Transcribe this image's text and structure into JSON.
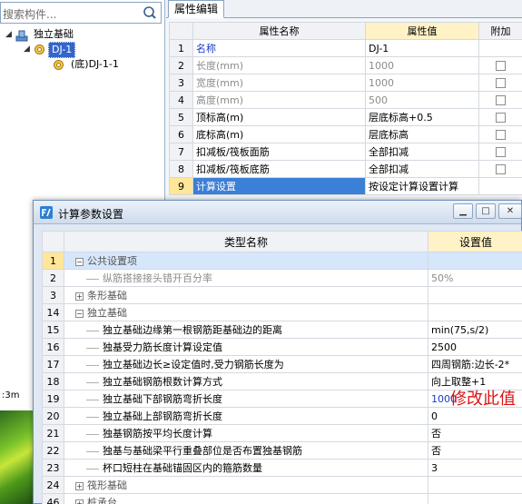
{
  "search": {
    "placeholder": "搜索构件..."
  },
  "tree": {
    "root_label": "独立基础",
    "child_label": "DJ-1",
    "grandchild_label": "(底)DJ-1-1"
  },
  "status": {
    "text": ":3m"
  },
  "property_panel": {
    "tab_label": "属性编辑",
    "headers": {
      "name": "属性名称",
      "value": "属性值",
      "extra": "附加"
    },
    "rows": [
      {
        "num": "1",
        "name": "名称",
        "value": "DJ-1",
        "checkbox": false,
        "style": "blue"
      },
      {
        "num": "2",
        "name": "长度(mm)",
        "value": "1000",
        "checkbox": true,
        "style": "gray"
      },
      {
        "num": "3",
        "name": "宽度(mm)",
        "value": "1000",
        "checkbox": true,
        "style": "gray"
      },
      {
        "num": "4",
        "name": "高度(mm)",
        "value": "500",
        "checkbox": true,
        "style": "gray"
      },
      {
        "num": "5",
        "name": "顶标高(m)",
        "value": "层底标高+0.5",
        "checkbox": true,
        "style": "normal"
      },
      {
        "num": "6",
        "name": "底标高(m)",
        "value": "层底标高",
        "checkbox": true,
        "style": "normal"
      },
      {
        "num": "7",
        "name": "扣减板/筏板面筋",
        "value": "全部扣减",
        "checkbox": true,
        "style": "normal"
      },
      {
        "num": "8",
        "name": "扣减板/筏板底筋",
        "value": "全部扣减",
        "checkbox": true,
        "style": "normal"
      },
      {
        "num": "9",
        "name": "计算设置",
        "value": "按设定计算设置计算",
        "checkbox": false,
        "style": "selected"
      }
    ]
  },
  "dialog": {
    "title": "计算参数设置",
    "headers": {
      "name": "类型名称",
      "value": "设置值"
    },
    "rows": [
      {
        "num": "1",
        "name": "公共设置项",
        "value": "",
        "kind": "group-open",
        "selected": true
      },
      {
        "num": "2",
        "name": "纵筋搭接接头错开百分率",
        "value": "50%",
        "kind": "item-gray"
      },
      {
        "num": "3",
        "name": "条形基础",
        "value": "",
        "kind": "group-closed"
      },
      {
        "num": "14",
        "name": "独立基础",
        "value": "",
        "kind": "group-open"
      },
      {
        "num": "15",
        "name": "独立基础边缘第一根钢筋距基础边的距离",
        "value": "min(75,s/2)",
        "kind": "item"
      },
      {
        "num": "16",
        "name": "独基受力筋长度计算设定值",
        "value": "2500",
        "kind": "item"
      },
      {
        "num": "17",
        "name": "独立基础边长≥设定值时,受力钢筋长度为",
        "value": "四周钢筋:边长-2*",
        "kind": "item"
      },
      {
        "num": "18",
        "name": "独立基础钢筋根数计算方式",
        "value": "向上取整+1",
        "kind": "item"
      },
      {
        "num": "19",
        "name": "独立基础下部钢筋弯折长度",
        "value": "1000",
        "kind": "item-blue"
      },
      {
        "num": "20",
        "name": "独立基础上部钢筋弯折长度",
        "value": "0",
        "kind": "item"
      },
      {
        "num": "21",
        "name": "独基钢筋按平均长度计算",
        "value": "否",
        "kind": "item"
      },
      {
        "num": "22",
        "name": "独基与基础梁平行重叠部位是否布置独基钢筋",
        "value": "否",
        "kind": "item"
      },
      {
        "num": "23",
        "name": "杯口短柱在基础锚固区内的箍筋数量",
        "value": "3",
        "kind": "item"
      },
      {
        "num": "24",
        "name": "筏形基础",
        "value": "",
        "kind": "group-closed"
      },
      {
        "num": "46",
        "name": "桩承台",
        "value": "",
        "kind": "group-closed"
      }
    ]
  },
  "annotation": {
    "text": "修改此值",
    "color": "#e11111"
  },
  "colors": {
    "selection": "#3366cc",
    "value_header": "#fff2c6",
    "selected_rownum": "#ffe699"
  }
}
